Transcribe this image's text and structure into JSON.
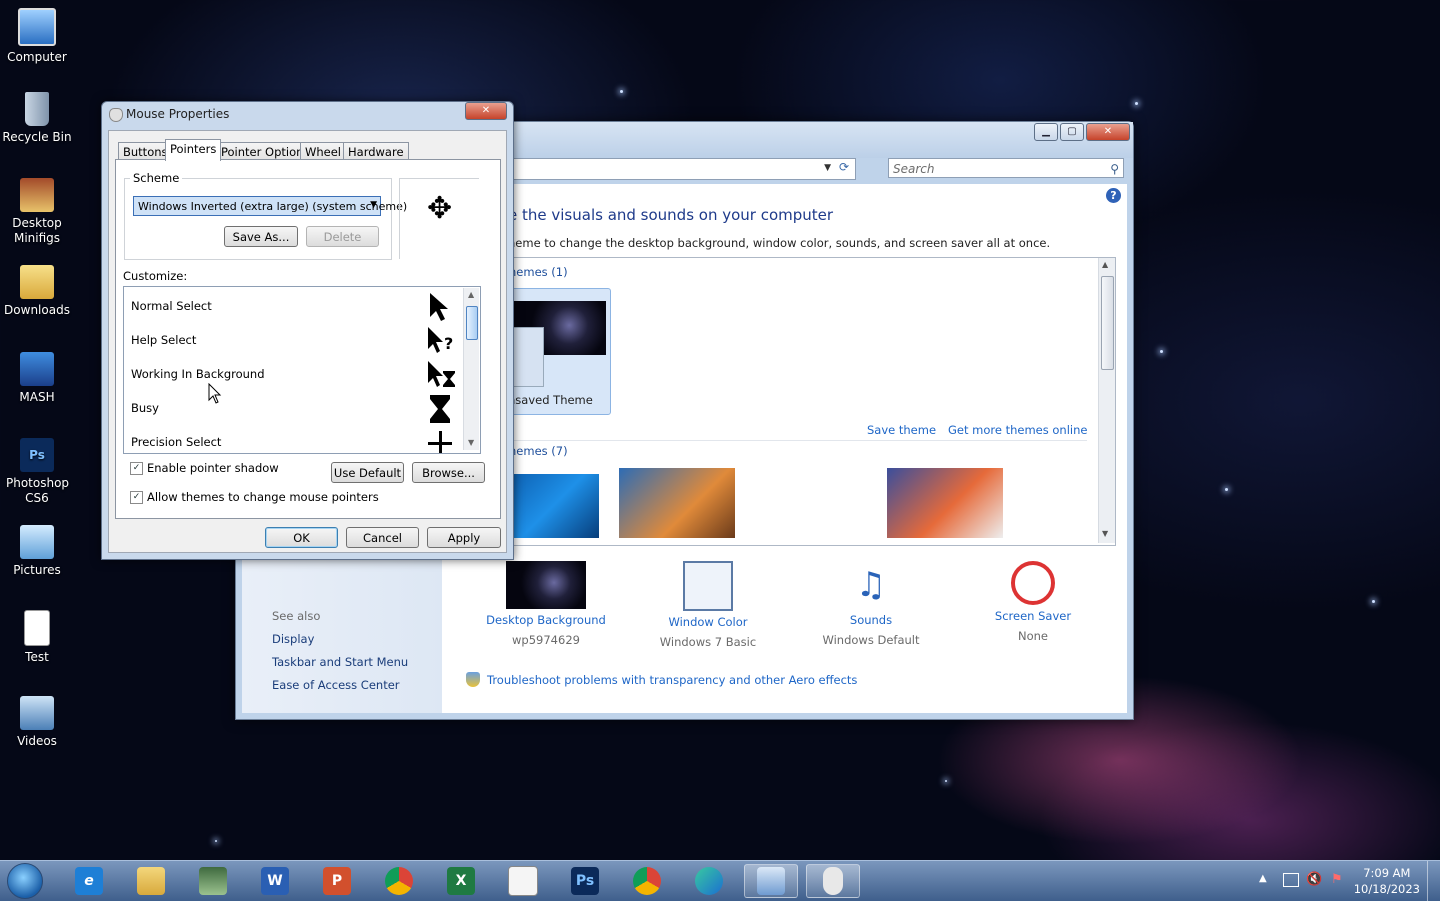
{
  "desktop": {
    "icons": [
      {
        "label": "Computer"
      },
      {
        "label": "Recycle Bin"
      },
      {
        "label": "Desktop Minifigs"
      },
      {
        "label": "Downloads"
      },
      {
        "label": "MASH"
      },
      {
        "label": "Photoshop CS6"
      },
      {
        "label": "Pictures"
      },
      {
        "label": "Test"
      },
      {
        "label": "Videos"
      }
    ]
  },
  "personalization": {
    "search_placeholder": "Search",
    "heading": "e the visuals and sounds on your computer",
    "subheading": "heme to change the desktop background, window color, sounds, and screen saver all at once.",
    "my_themes_label": "hemes (1)",
    "unsaved_theme_label": "nsaved Theme",
    "save_theme": "Save theme",
    "get_more_themes": "Get more themes online",
    "aero_themes_label": "hemes (7)",
    "see_also": "See also",
    "left_links": [
      "Display",
      "Taskbar and Start Menu",
      "Ease of Access Center"
    ],
    "bottom": [
      {
        "label": "Desktop Background",
        "value": "wp5974629"
      },
      {
        "label": "Window Color",
        "value": "Windows 7 Basic"
      },
      {
        "label": "Sounds",
        "value": "Windows Default"
      },
      {
        "label": "Screen Saver",
        "value": "None"
      }
    ],
    "troubleshoot": "Troubleshoot problems with transparency and other Aero effects"
  },
  "mouse_dialog": {
    "title": "Mouse Properties",
    "close": "✕",
    "tabs": [
      "Buttons",
      "Pointers",
      "Pointer Options",
      "Wheel",
      "Hardware"
    ],
    "active_tab": "Pointers",
    "scheme_label": "Scheme",
    "scheme_value": "Windows Inverted (extra large) (system scheme)",
    "save_as": "Save As...",
    "delete": "Delete",
    "customize_label": "Customize:",
    "cursors": [
      "Normal Select",
      "Help Select",
      "Working In Background",
      "Busy",
      "Precision Select"
    ],
    "enable_shadow": "Enable pointer shadow",
    "use_default": "Use Default",
    "browse": "Browse...",
    "allow_themes": "Allow themes to change mouse pointers",
    "ok": "OK",
    "cancel": "Cancel",
    "apply": "Apply"
  },
  "taskbar": {
    "time": "7:09 AM",
    "date": "10/18/2023"
  }
}
